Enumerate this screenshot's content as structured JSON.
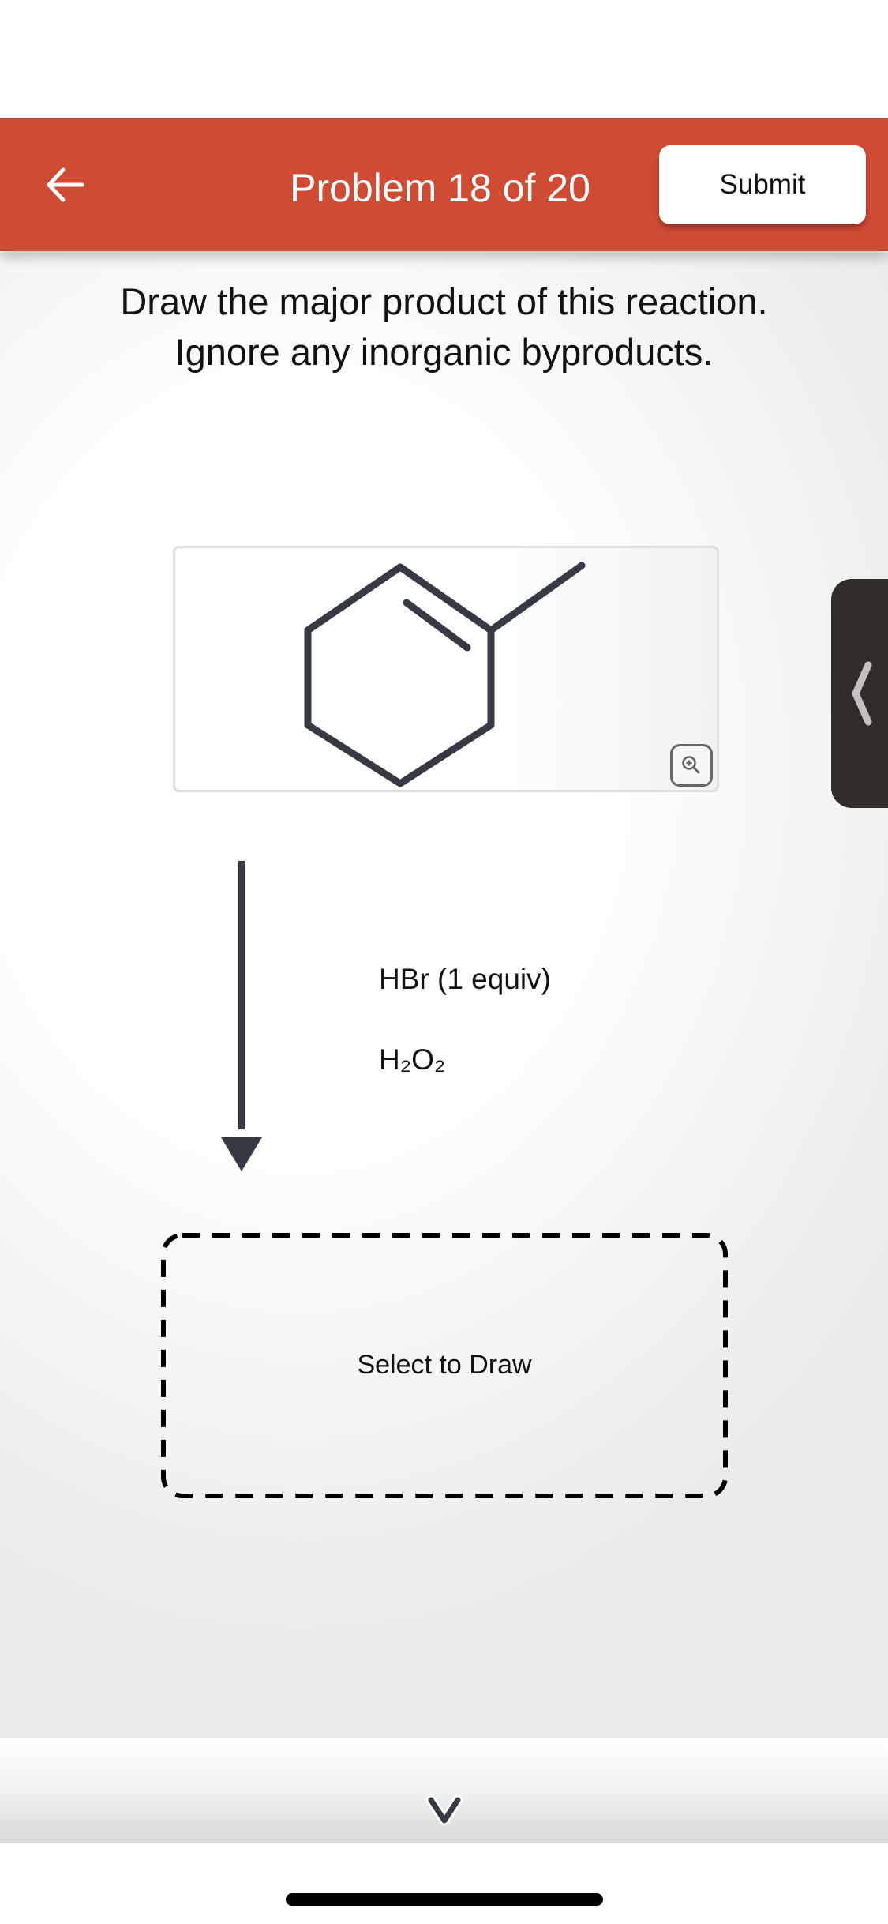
{
  "header": {
    "back_icon": "arrow-left-icon",
    "title": "Problem 18 of 20",
    "submit_label": "Submit",
    "color": "#d04b34"
  },
  "prompt": {
    "line1": "Draw the major product of this reaction.",
    "line2": "Ignore any inorganic byproducts."
  },
  "reactant": {
    "name": "1-methylcyclohexene",
    "zoom_icon": "zoom-in-icon"
  },
  "reaction": {
    "arrow_icon": "reaction-arrow-down",
    "reagents": [
      "HBr (1 equiv)",
      "H₂O₂"
    ]
  },
  "answer": {
    "placeholder": "Select to Draw"
  },
  "side_drawer": {
    "icon": "chevron-left-icon"
  },
  "bottom": {
    "expand_icon": "chevron-down-icon"
  }
}
